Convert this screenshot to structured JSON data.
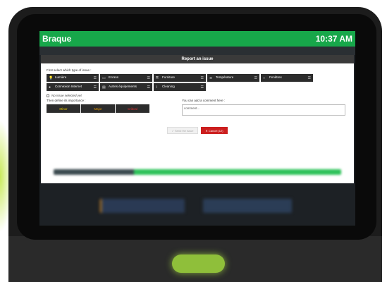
{
  "device": {
    "app_name": "Braque",
    "clock": "10:37 AM",
    "accent_green": "#17a74a",
    "home_button_color": "#8fbf3a"
  },
  "modal": {
    "title": "Report an issue",
    "select_prompt": "First select which type of issue :",
    "issue_types": [
      {
        "icon": "lightbulb-icon",
        "glyph": "💡",
        "label": "Lumière"
      },
      {
        "icon": "monitor-icon",
        "glyph": "▭",
        "label": "Ecrans"
      },
      {
        "icon": "chair-icon",
        "glyph": "Ħ",
        "label": "Furniture"
      },
      {
        "icon": "air-icon",
        "glyph": "≋",
        "label": "Température"
      },
      {
        "icon": "circle-icon",
        "glyph": "○",
        "label": "Fenêtres"
      },
      {
        "icon": "globe-icon",
        "glyph": "●",
        "label": "Connexion Internet"
      },
      {
        "icon": "keyboard-icon",
        "glyph": "▤",
        "label": "Autres équipements"
      },
      {
        "icon": "cleaning-icon",
        "glyph": "⌇",
        "label": "Cleaning"
      }
    ],
    "status_text": "No issue selected yet",
    "importance_prompt": "Then define its importance :",
    "levels": {
      "minor": "Minor",
      "major": "Major",
      "critical": "Critical"
    },
    "comment_prompt": "You can add a comment here :",
    "comment_placeholder": "comment...",
    "send_label": "Send the issue",
    "cancel_label": "Cancel (12)"
  }
}
